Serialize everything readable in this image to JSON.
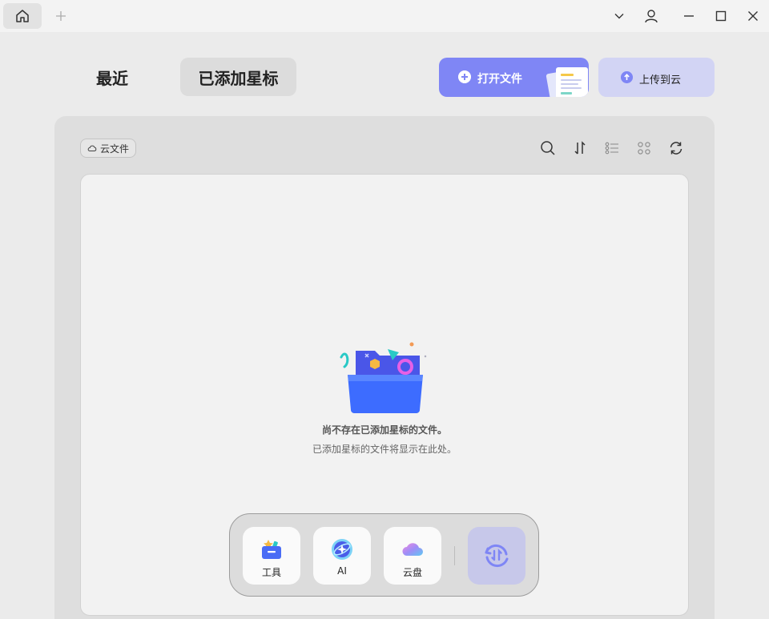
{
  "titlebar": {
    "home_icon": "home-icon",
    "new_tab_icon": "plus-icon",
    "controls": [
      "chevron-down-icon",
      "user-icon",
      "minimize-icon",
      "maximize-icon",
      "close-icon"
    ]
  },
  "header": {
    "tabs": [
      {
        "label": "最近",
        "active": false
      },
      {
        "label": "已添加星标",
        "active": true
      }
    ],
    "open_file_label": "打开文件",
    "upload_label": "上传到云"
  },
  "toolbar": {
    "cloud_chip_label": "云文件",
    "icons": [
      "search-icon",
      "sort-icon",
      "list-view-icon",
      "grid-view-icon",
      "refresh-icon"
    ]
  },
  "empty_state": {
    "title": "尚不存在已添加星标的文件。",
    "subtitle": "已添加星标的文件将显示在此处。"
  },
  "dock": {
    "items": [
      {
        "label": "工具",
        "icon": "toolbox-icon"
      },
      {
        "label": "AI",
        "icon": "ai-icon"
      },
      {
        "label": "云盘",
        "icon": "cloud-icon"
      }
    ],
    "convert_icon": "convert-icon"
  },
  "colors": {
    "accent": "#7f86f5",
    "accent_light": "#d2d4f4",
    "background": "#ebebeb",
    "panel": "#dedede",
    "content": "#f2f2f2"
  }
}
